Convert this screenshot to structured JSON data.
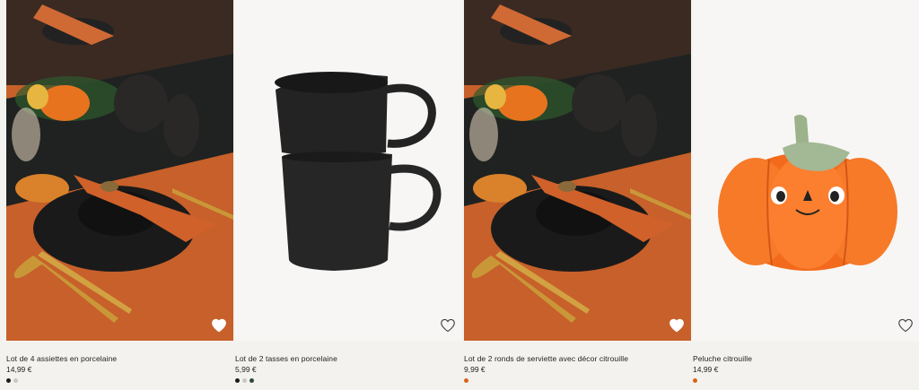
{
  "products": [
    {
      "name": "Lot de 4 assiettes en porcelaine",
      "price": "14,99 €",
      "swatches": [
        "#1b1b1b",
        "#c8c8c8"
      ],
      "favorite_icon": "heart-outline-icon"
    },
    {
      "name": "Lot de 2 tasses en porcelaine",
      "price": "5,99 €",
      "swatches": [
        "#1b1b1b",
        "#c8c8c8",
        "#2f4a3c"
      ],
      "favorite_icon": "heart-outline-icon"
    },
    {
      "name": "Lot de 2 ronds de serviette avec décor citrouille",
      "price": "9,99 €",
      "swatches": [
        "#d8641c"
      ],
      "favorite_icon": "heart-outline-icon"
    },
    {
      "name": "Peluche citrouille",
      "price": "14,99 €",
      "swatches": [
        "#d8641c"
      ],
      "favorite_icon": "heart-outline-icon"
    }
  ]
}
